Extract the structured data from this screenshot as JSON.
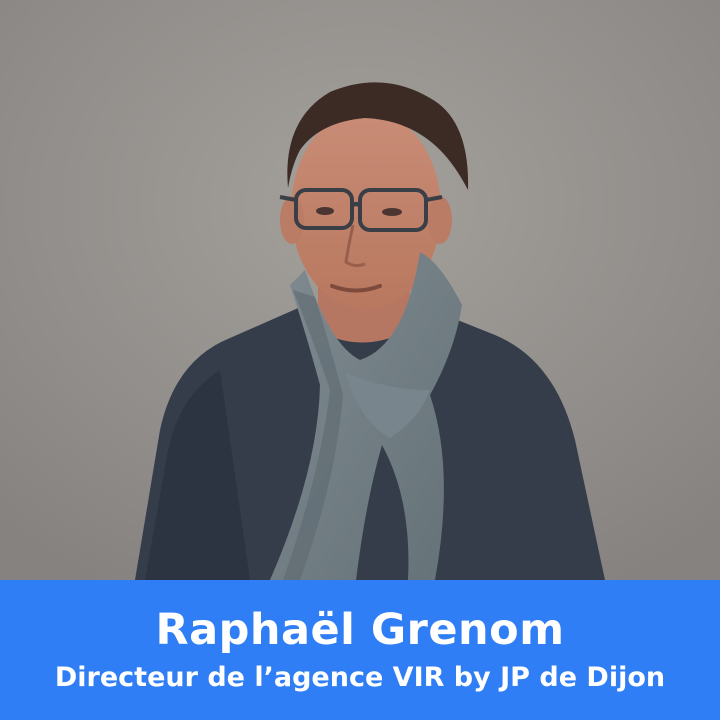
{
  "caption": {
    "name": "Raphaël Grenom",
    "role": "Directeur de l’agence VIR by JP de Dijon",
    "background_color": "#2f7ef5",
    "text_color": "#ffffff"
  },
  "scene": {
    "subject": "man-with-glasses-and-scarf",
    "background_color": "#9a9792"
  }
}
